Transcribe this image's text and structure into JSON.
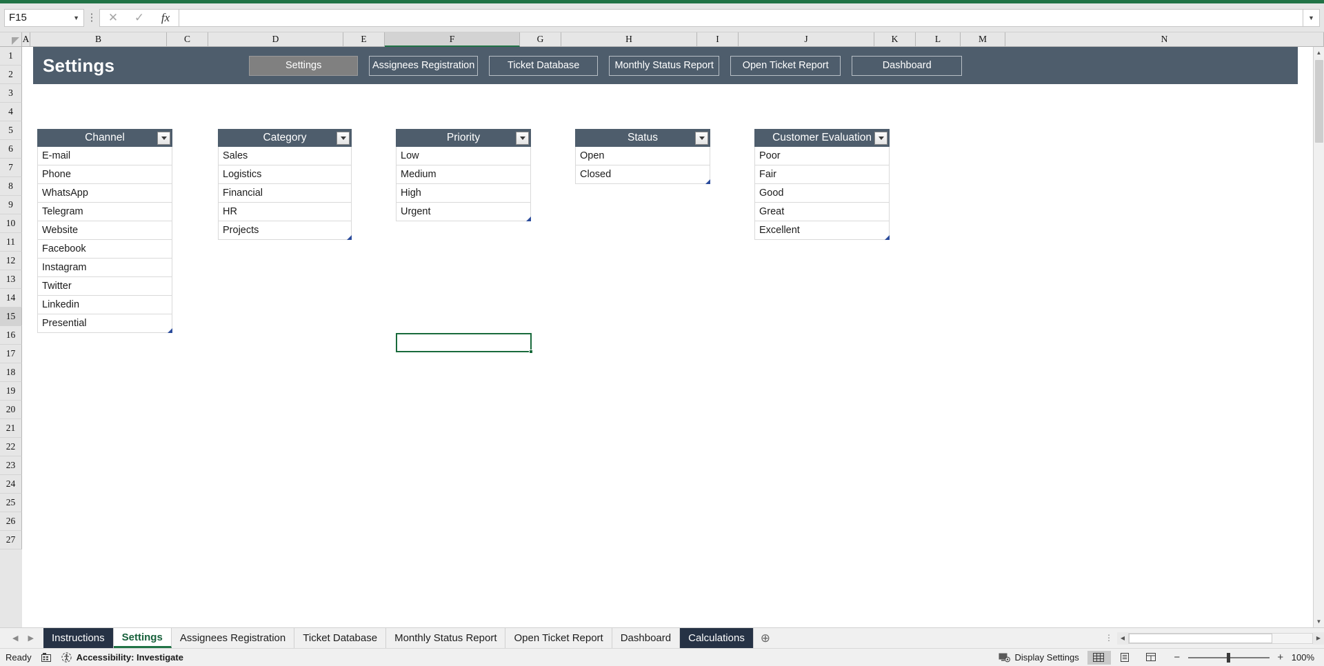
{
  "formula_bar": {
    "name_box_value": "F15",
    "formula_value": "",
    "cancel_icon": "close-icon",
    "confirm_icon": "check-icon",
    "function_icon": "fx-icon",
    "expand_icon": "chevron-down-icon"
  },
  "grid": {
    "columns": [
      "A",
      "B",
      "C",
      "D",
      "E",
      "F",
      "G",
      "H",
      "I",
      "J",
      "K",
      "L",
      "M",
      "N"
    ],
    "active_column": "F",
    "active_row": "15",
    "rows": [
      "1",
      "2",
      "3",
      "4",
      "5",
      "6",
      "7",
      "8",
      "9",
      "10",
      "11",
      "12",
      "13",
      "14",
      "15",
      "16",
      "17",
      "18",
      "19",
      "20",
      "21",
      "22",
      "23",
      "24",
      "25",
      "26",
      "27"
    ]
  },
  "banner": {
    "title": "Settings",
    "background_color": "#4e5d6c",
    "nav_buttons": [
      {
        "label": "Settings",
        "active": true
      },
      {
        "label": "Assignees Registration",
        "active": false
      },
      {
        "label": "Ticket Database",
        "active": false
      },
      {
        "label": "Monthly Status Report",
        "active": false
      },
      {
        "label": "Open Ticket Report",
        "active": false
      },
      {
        "label": "Dashboard",
        "active": false
      }
    ]
  },
  "lookup_tables": [
    {
      "header": "Channel",
      "items": [
        "E-mail",
        "Phone",
        "WhatsApp",
        "Telegram",
        "Website",
        "Facebook",
        "Instagram",
        "Twitter",
        "Linkedin",
        "Presential"
      ]
    },
    {
      "header": "Category",
      "items": [
        "Sales",
        "Logistics",
        "Financial",
        "HR",
        "Projects"
      ]
    },
    {
      "header": "Priority",
      "items": [
        "Low",
        "Medium",
        "High",
        "Urgent"
      ]
    },
    {
      "header": "Status",
      "items": [
        "Open",
        "Closed"
      ]
    },
    {
      "header": "Customer Evaluation",
      "items": [
        "Poor",
        "Fair",
        "Good",
        "Great",
        "Excellent"
      ]
    }
  ],
  "sheet_tabs": {
    "prev_icon": "chevron-left-icon",
    "next_icon": "chevron-right-icon",
    "add_icon": "plus-icon",
    "tabs": [
      {
        "label": "Instructions",
        "state": "colored"
      },
      {
        "label": "Settings",
        "state": "active"
      },
      {
        "label": "Assignees Registration",
        "state": "normal"
      },
      {
        "label": "Ticket Database",
        "state": "normal"
      },
      {
        "label": "Monthly Status Report",
        "state": "normal"
      },
      {
        "label": "Open Ticket Report",
        "state": "normal"
      },
      {
        "label": "Dashboard",
        "state": "normal"
      },
      {
        "label": "Calculations",
        "state": "colored"
      }
    ]
  },
  "status_bar": {
    "ready_text": "Ready",
    "macro_icon": "record-macro-icon",
    "accessibility_icon": "accessibility-icon",
    "accessibility_text": "Accessibility: Investigate",
    "display_settings_icon": "display-settings-icon",
    "display_settings_text": "Display Settings",
    "view_normal_icon": "normal-view-icon",
    "view_pagelayout_icon": "page-layout-view-icon",
    "view_pagebreak_icon": "page-break-view-icon",
    "zoom_out_label": "−",
    "zoom_in_label": "+",
    "zoom_level": "100%"
  }
}
